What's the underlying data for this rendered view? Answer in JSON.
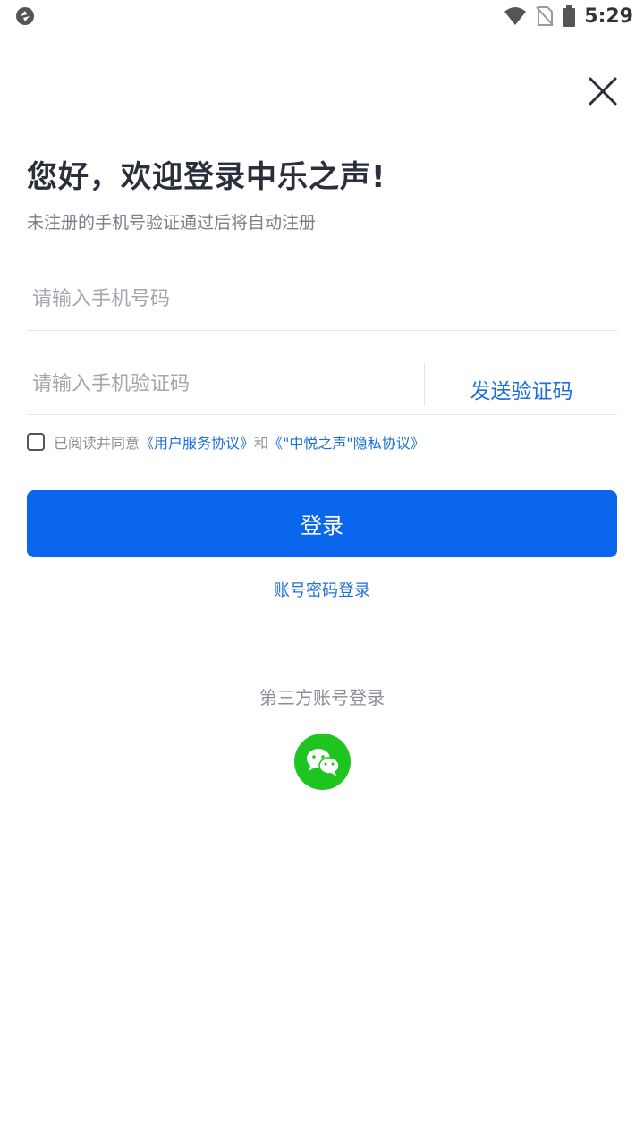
{
  "status_bar": {
    "time": "5:29",
    "icons": [
      "app-sync-icon",
      "wifi-icon",
      "no-sim-icon",
      "battery-icon"
    ]
  },
  "header": {
    "close_icon": "close-icon"
  },
  "main": {
    "title": "您好，欢迎登录中乐之声!",
    "subtitle": "未注册的手机号验证通过后将自动注册",
    "phone_placeholder": "请输入手机号码",
    "code_placeholder": "请输入手机验证码",
    "send_code_label": "发送验证码",
    "agreement": {
      "prefix": "已阅读并同意",
      "user_agreement": "《用户服务协议》",
      "and": "和",
      "privacy_policy": "《\"中悦之声\"隐私协议》",
      "checked": false
    },
    "login_label": "登录",
    "password_login_label": "账号密码登录",
    "third_party_title": "第三方账号登录",
    "wechat_icon": "wechat-icon"
  },
  "colors": {
    "primary": "#0b66ee",
    "link": "#1e6fd9",
    "wechat": "#1ec41f"
  }
}
